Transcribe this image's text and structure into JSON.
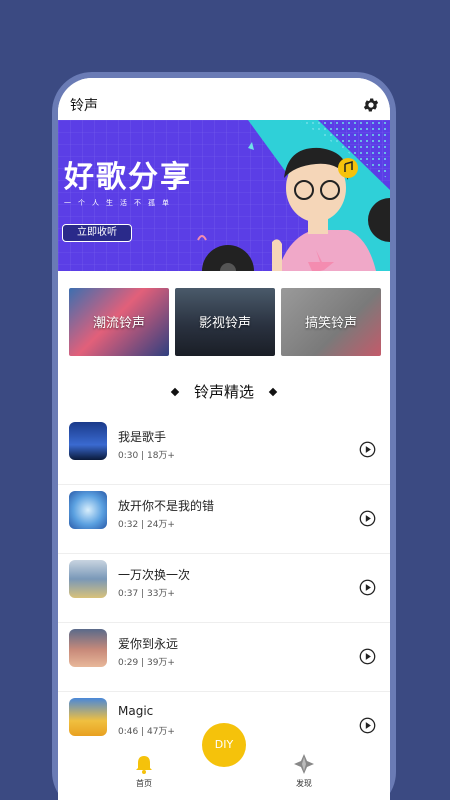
{
  "app": {
    "title": "铃声"
  },
  "banner": {
    "title": "好歌分享",
    "subtitle": "一个人生活不孤单",
    "button_label": "立即收听"
  },
  "categories": [
    {
      "label": "潮流铃声"
    },
    {
      "label": "影视铃声"
    },
    {
      "label": "搞笑铃声"
    }
  ],
  "section": {
    "title": "铃声精选"
  },
  "songs": [
    {
      "name": "我是歌手",
      "meta": "0:30 | 18万+"
    },
    {
      "name": "放开你不是我的错",
      "meta": "0:32 | 24万+"
    },
    {
      "name": "一万次换一次",
      "meta": "0:37 | 33万+"
    },
    {
      "name": "爱你到永远",
      "meta": "0:29 | 39万+"
    },
    {
      "name": "Magic",
      "meta": "0:46 | 47万+"
    }
  ],
  "tabs": {
    "home": "首页",
    "diy": "DIY",
    "discover": "发现"
  },
  "colors": {
    "background": "#3b4a82",
    "banner": "#5b3ee6",
    "diy": "#f5c20b",
    "tab_active": "#f5c20b"
  }
}
